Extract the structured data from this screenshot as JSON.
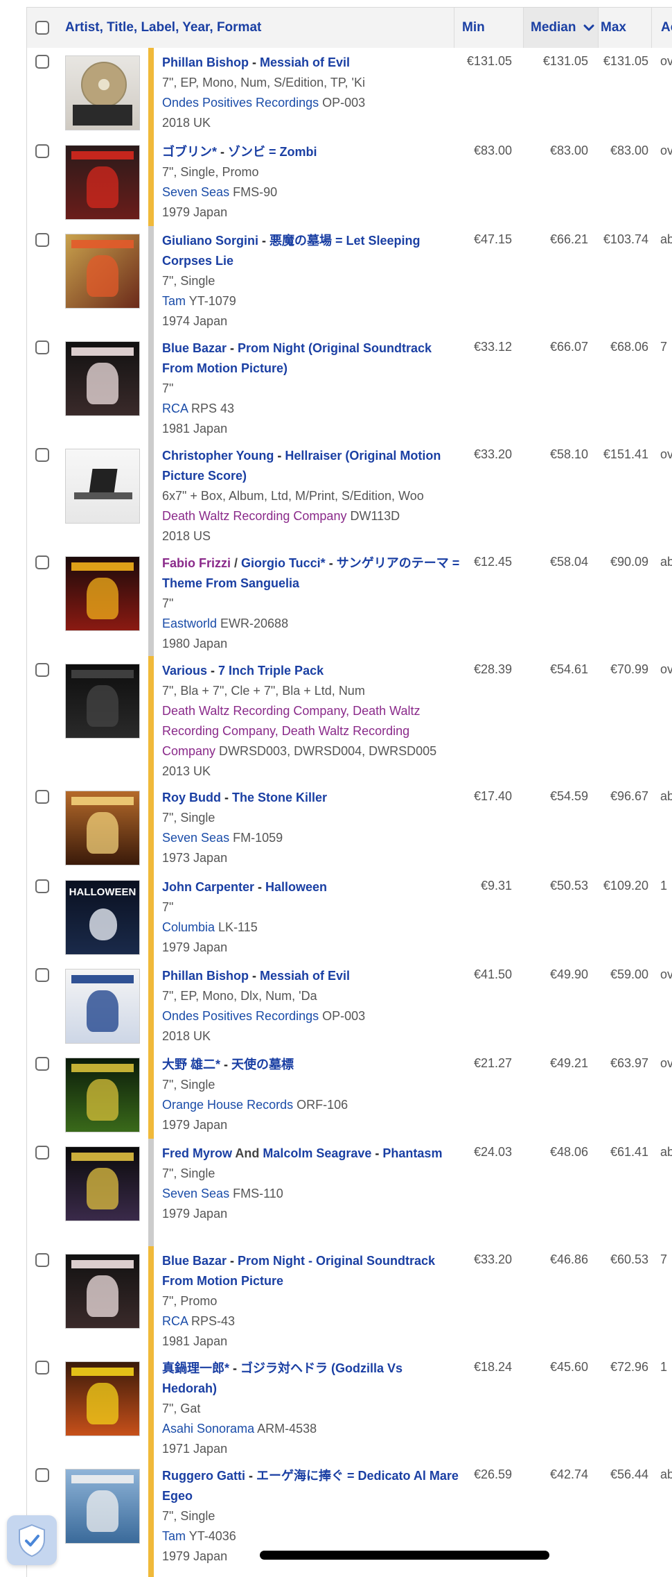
{
  "header": {
    "release_col": "Artist, Title, Label, Year, Format",
    "min_col": "Min",
    "median_col": "Median",
    "max_col": "Max",
    "added_col": "Ac"
  },
  "colors": {
    "accent": "#1a3fa3",
    "bar_yellow": "#f0b93a",
    "bar_gray": "#cccccc",
    "label_purple": "#8a2a8a"
  },
  "rows": [
    {
      "artist": "Phillan Bishop",
      "title": "Messiah of Evil",
      "format": "7\", EP, Mono, Num, S/Edition, TP, 'Ki",
      "labels": "Ondes Positives Recordings",
      "catno": "OP-003",
      "year_country": "2018 UK",
      "min": "€131.05",
      "median": "€131.05",
      "max": "€131.05",
      "extra": "ov",
      "bar": "yellow",
      "art": "Box set photo"
    },
    {
      "artist": "ゴブリン*",
      "title": "ゾンビ = Zombi",
      "format": "7\", Single, Promo",
      "labels": "Seven Seas",
      "catno": "FMS-90",
      "year_country": "1979 Japan",
      "min": "€83.00",
      "median": "€83.00",
      "max": "€83.00",
      "extra": "ov",
      "bar": "yellow",
      "art": "Zombi cover"
    },
    {
      "artist": "Giuliano Sorgini",
      "title": "悪魔の墓場 = Let Sleeping Corpses Lie",
      "format": "7\", Single",
      "labels": "Tam",
      "catno": "YT-1079",
      "year_country": "1974 Japan",
      "min": "€47.15",
      "median": "€66.21",
      "max": "€103.74",
      "extra": "ab",
      "bar": "gray",
      "art": "Let Sleeping Corpses Lie cover"
    },
    {
      "artist": "Blue Bazar",
      "title": "Prom Night (Original Soundtrack From Motion Picture)",
      "format": "7\"",
      "labels": "RCA",
      "catno": "RPS 43",
      "year_country": "1981 Japan",
      "min": "€33.12",
      "median": "€66.07",
      "max": "€68.06",
      "extra": "7",
      "bar": "gray",
      "art": "Prom Night cover"
    },
    {
      "artist": "Christopher Young",
      "title": "Hellraiser (Original Motion Picture Score)",
      "format": "6x7\" + Box, Album, Ltd, M/Print, S/Edition, Woo",
      "labels": "Death Waltz Recording Company",
      "catno": "DW113D",
      "year_country": "2018 US",
      "min": "€33.20",
      "median": "€58.10",
      "max": "€151.41",
      "extra": "ov",
      "bar": "gray",
      "art": "Hellraiser box"
    },
    {
      "artist": "Fabio Frizzi",
      "artist2": "Giorgio Tucci*",
      "title": "サンゲリアのテーマ = Theme From Sanguelia",
      "format": "7\"",
      "labels": "Eastworld",
      "catno": "EWR-20688",
      "year_country": "1980 Japan",
      "min": "€12.45",
      "median": "€58.04",
      "max": "€90.09",
      "extra": "ab",
      "bar": "gray",
      "art": "Sanguelia cover"
    },
    {
      "artist": "Various",
      "title": "7 Inch Triple Pack",
      "format": "7\", Bla + 7\", Cle + 7\", Bla + Ltd, Num",
      "labels": "Death Waltz Recording Company, Death Waltz Recording Company, Death Waltz Recording Company",
      "catno": "DWRSD003, DWRSD004, DWRSD005",
      "year_country": "2013 UK",
      "min": "€28.39",
      "median": "€54.61",
      "max": "€70.99",
      "extra": "ov",
      "bar": "yellow",
      "art": "Triple pack"
    },
    {
      "artist": "Roy Budd",
      "title": "The Stone Killer",
      "format": "7\", Single",
      "labels": "Seven Seas",
      "catno": "FM-1059",
      "year_country": "1973 Japan",
      "min": "€17.40",
      "median": "€54.59",
      "max": "€96.67",
      "extra": "ab",
      "bar": "yellow",
      "art": "Stone Killer cover"
    },
    {
      "artist": "John Carpenter",
      "title": "Halloween",
      "format": "7\"",
      "labels": "Columbia",
      "catno": "LK-115",
      "year_country": "1979 Japan",
      "min": "€9.31",
      "median": "€50.53",
      "max": "€109.20",
      "extra": "1",
      "bar": "yellow",
      "art": "Halloween cover",
      "art_text": "HALLOWEEN"
    },
    {
      "artist": "Phillan Bishop",
      "title": "Messiah of Evil",
      "format": "7\", EP, Mono, Dlx, Num, 'Da",
      "labels": "Ondes Positives Recordings",
      "catno": "OP-003",
      "year_country": "2018 UK",
      "min": "€41.50",
      "median": "€49.90",
      "max": "€59.00",
      "extra": "ov",
      "bar": "yellow",
      "art": "Messiah of Evil deluxe"
    },
    {
      "artist": "大野 雄二*",
      "title": "天使の墓標",
      "format": "7\", Single",
      "labels": "Orange House Records",
      "catno": "ORF-106",
      "year_country": "1979 Japan",
      "min": "€21.27",
      "median": "€49.21",
      "max": "€63.97",
      "extra": "ov",
      "bar": "yellow",
      "art": "Angel grave cover"
    },
    {
      "artist": "Fred Myrow",
      "joiner": "And",
      "artist2": "Malcolm Seagrave",
      "title": "Phantasm",
      "format": "7\", Single",
      "labels": "Seven Seas",
      "catno": "FMS-110",
      "year_country": "1979 Japan",
      "min": "€24.03",
      "median": "€48.06",
      "max": "€61.41",
      "extra": "ab",
      "bar": "gray",
      "art": "Phantasm cover"
    },
    {
      "artist": "Blue Bazar",
      "title": "Prom Night - Original Soundtrack From Motion Picture",
      "format": "7\", Promo",
      "labels": "RCA",
      "catno": "RPS-43",
      "year_country": "1981 Japan",
      "min": "€33.20",
      "median": "€46.86",
      "max": "€60.53",
      "extra": "7",
      "bar": "yellow",
      "art": "Prom Night promo"
    },
    {
      "artist": "真鍋理一郎*",
      "title": "ゴジラ対ヘドラ (Godzilla Vs Hedorah)",
      "format": "7\", Gat",
      "labels": "Asahi Sonorama",
      "catno": "ARM-4538",
      "year_country": "1971 Japan",
      "min": "€18.24",
      "median": "€45.60",
      "max": "€72.96",
      "extra": "1",
      "bar": "yellow",
      "art": "Godzilla vs Hedorah"
    },
    {
      "artist": "Ruggero Gatti",
      "title": "エーゲ海に捧ぐ = Dedicato Al Mare Egeo",
      "format": "7\", Single",
      "labels": "Tam",
      "catno": "YT-4036",
      "year_country": "1979 Japan",
      "min": "€26.59",
      "median": "€42.74",
      "max": "€56.44",
      "extra": "ab",
      "bar": "yellow",
      "art": "Aegean sea cover"
    }
  ]
}
